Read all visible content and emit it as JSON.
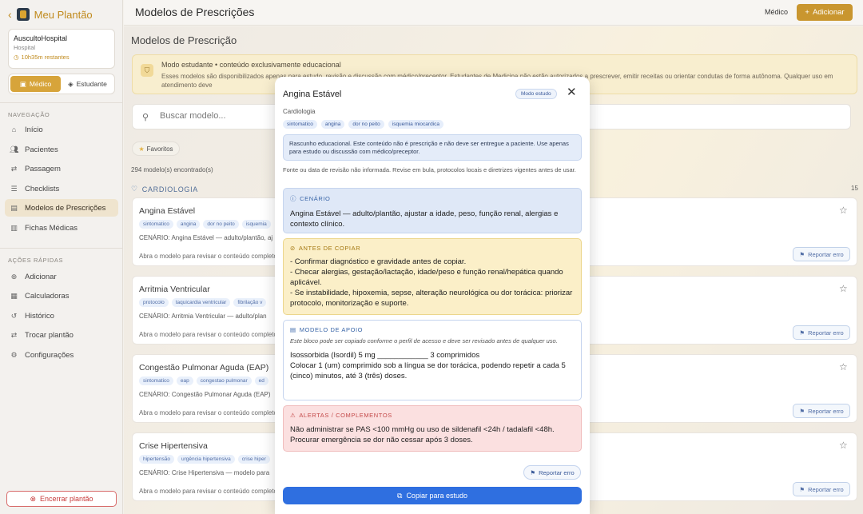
{
  "sidebar": {
    "brand": "Meu Plantão",
    "hospital": {
      "name": "AuscultoHospital",
      "type": "Hospital",
      "remaining": "10h35m restantes"
    },
    "roles": {
      "medico": "Médico",
      "estudante": "Estudante"
    },
    "nav_title": "NAVEGAÇÃO",
    "nav": [
      {
        "label": "Início",
        "icon": "home-icon"
      },
      {
        "label": "Pacientes",
        "icon": "users-icon"
      },
      {
        "label": "Passagem",
        "icon": "swap-icon"
      },
      {
        "label": "Checklists",
        "icon": "checklist-icon"
      },
      {
        "label": "Modelos de Prescrições",
        "icon": "document-icon"
      },
      {
        "label": "Fichas Médicas",
        "icon": "file-icon"
      }
    ],
    "quick_title": "AÇÕES RÁPIDAS",
    "quick": [
      {
        "label": "Adicionar",
        "icon": "plus-circle-icon"
      },
      {
        "label": "Calculadoras",
        "icon": "calculator-icon"
      },
      {
        "label": "Histórico",
        "icon": "history-icon"
      },
      {
        "label": "Trocar plantão",
        "icon": "swap-icon"
      },
      {
        "label": "Configurações",
        "icon": "gear-icon"
      }
    ],
    "end_shift": "Encerrar plantão"
  },
  "header": {
    "title": "Modelos de Prescrições",
    "role": "Médico",
    "add_label": "Adicionar"
  },
  "main": {
    "page_title": "Modelos de Prescrição",
    "edu_banner": {
      "title": "Modo estudante • conteúdo exclusivamente educacional",
      "text": "Esses modelos são disponibilizados apenas para estudo, revisão e discussão com médico/preceptor. Estudantes de Medicina não estão autorizados a prescrever, emitir receitas ou orientar condutas de forma autônoma. Qualquer uso em atendimento deve"
    },
    "search_placeholder": "Buscar modelo...",
    "favorites": "Favoritos",
    "count": "294 modelo(s) encontrado(s)",
    "category": "CARDIOLOGIA",
    "category_count": "15",
    "hint": "Abra o modelo para revisar o conteúdo completo",
    "report": "Reportar erro",
    "cards": [
      {
        "name": "Angina Estável",
        "tags": [
          "sintomatico",
          "angina",
          "dor no peito",
          "isquemia"
        ],
        "scenario": "CENÁRIO: Angina Estável — adulto/plantão, aj"
      },
      {
        "name": "Arritmia Ventricular",
        "tags": [
          "protocolo",
          "taquicardia ventricular",
          "fibrilação v"
        ],
        "scenario": "CENÁRIO: Arritmia Ventricular — adulto/plan"
      },
      {
        "name": "Congestão Pulmonar Aguda (EAP)",
        "tags": [
          "sintomatico",
          "eap",
          "congestao pulmonar",
          "ed"
        ],
        "scenario": "CENÁRIO: Congestão Pulmonar Aguda (EAP)"
      },
      {
        "name": "Crise Hipertensiva",
        "tags": [
          "hipertensão",
          "urgência hipertensiva",
          "crise hiper"
        ],
        "scenario": "CENÁRIO: Crise Hipertensiva — modelo para"
      }
    ]
  },
  "modal": {
    "title": "Angina Estável",
    "badge": "Modo estudo",
    "specialty": "Cardiologia",
    "tags": [
      "sintomatico",
      "angina",
      "dor no peito",
      "isquemia miocardica"
    ],
    "draft": "Rascunho educacional. Este conteúdo não é prescrição e não deve ser entregue a paciente. Use apenas para estudo ou discussão com médico/preceptor.",
    "source": "Fonte ou data de revisão não informada. Revise em bula, protocolos locais e diretrizes vigentes antes de usar.",
    "scenario": {
      "heading": "CENÁRIO",
      "text": "Angina Estável — adulto/plantão, ajustar a idade, peso, função renal, alergias e contexto clínico."
    },
    "before_copy": {
      "heading": "ANTES DE COPIAR",
      "lines": [
        "- Confirmar diagnóstico e gravidade antes de copiar.",
        "- Checar alergias, gestação/lactação, idade/peso e função renal/hepática quando aplicável.",
        "- Se instabilidade, hipoxemia, sepse, alteração neurológica ou dor torácica: priorizar protocolo, monitorização e suporte."
      ]
    },
    "model": {
      "heading": "MODELO DE APOIO",
      "note": "Este bloco pode ser copiado conforme o perfil de acesso e deve ser revisado antes de qualquer uso.",
      "lines": [
        "Isossorbida (Isordil) 5 mg ____________ 3 comprimidos",
        "Colocar 1 (um) comprimido sob a língua se dor torácica, podendo repetir a cada 5 (cinco) minutos, até 3 (três) doses."
      ]
    },
    "alerts": {
      "heading": "ALERTAS / COMPLEMENTOS",
      "text": "Não administrar se PAS <100 mmHg ou uso de sildenafil <24h / tadalafil <48h. Procurar emergência se dor não cessar após 3 doses."
    },
    "report": "Reportar erro",
    "copy": "Copiar para estudo"
  }
}
